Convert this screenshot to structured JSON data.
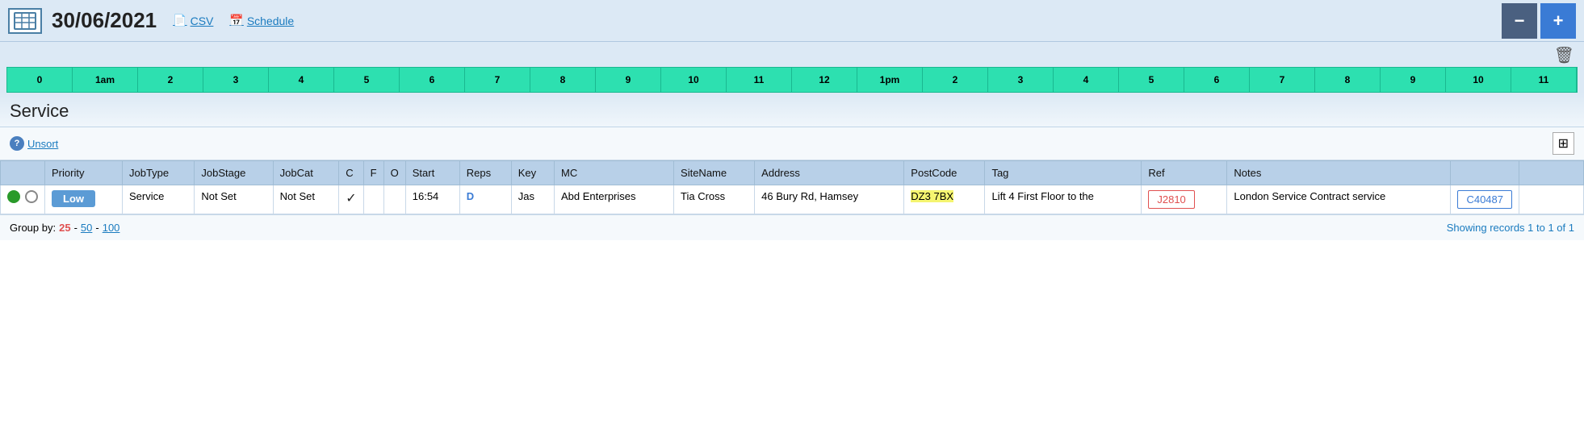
{
  "header": {
    "date": "30/06/2021",
    "csv_label": "CSV",
    "schedule_label": "Schedule",
    "btn_minus": "−",
    "btn_plus": "+"
  },
  "timeline": {
    "ticks": [
      "0",
      "1am",
      "2",
      "3",
      "4",
      "5",
      "6",
      "7",
      "8",
      "9",
      "10",
      "11",
      "12",
      "1pm",
      "2",
      "3",
      "4",
      "5",
      "6",
      "7",
      "8",
      "9",
      "10",
      "11"
    ]
  },
  "section": {
    "title": "Service"
  },
  "controls": {
    "unsort_label": "Unsort",
    "help_symbol": "?"
  },
  "table": {
    "columns": [
      "",
      "Priority",
      "JobType",
      "JobStage",
      "JobCat",
      "C",
      "F",
      "O",
      "Start",
      "Reps",
      "Key",
      "MC",
      "SiteName",
      "Address",
      "PostCode",
      "Tag",
      "Ref",
      "Notes",
      "",
      ""
    ],
    "rows": [
      {
        "dot_green": true,
        "dot_empty": true,
        "priority": "Low",
        "priority_color": "low",
        "job_type": "Service",
        "job_stage": "Not Set",
        "job_cat": "Not Set",
        "c": "✓",
        "f": "",
        "o": "",
        "start": "16:54",
        "reps": "D",
        "key": "Jas",
        "mc": "Abd Enterprises",
        "site_name": "Tia Cross",
        "address": "46 Bury Rd, Hamsey",
        "postcode": "DZ3 7BX",
        "tag": "Lift 4 First Floor to the",
        "ref": "J2810",
        "ref2": "C40487",
        "notes": "London Service Contract service"
      }
    ]
  },
  "footer": {
    "group_by_label": "Group by:",
    "group_active": "25",
    "group_50": "50",
    "group_100": "100",
    "records_label": "Showing records 1 to 1 of 1"
  }
}
